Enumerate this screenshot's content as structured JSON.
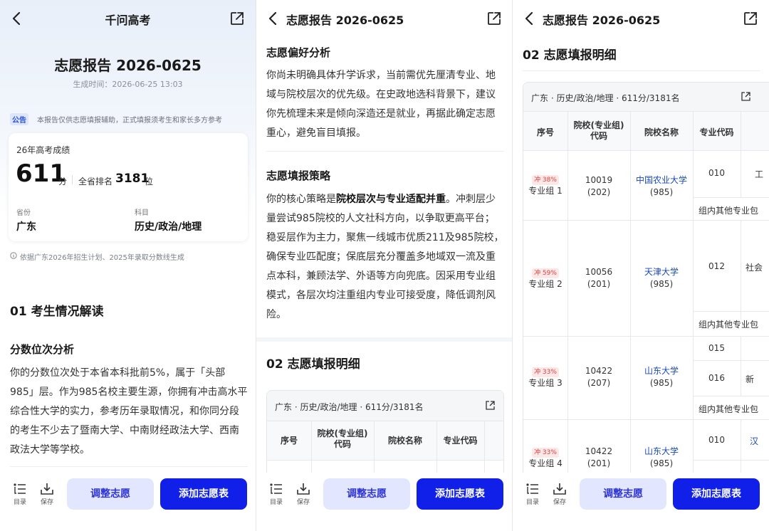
{
  "panel1": {
    "nav_title": "千问高考",
    "report_title": "志愿报告 2026-0625",
    "generated": "生成时间：2026-06-25 13:03",
    "notice_tag": "公告",
    "notice_text": "本报告仅供志愿填报辅助，正式填报须考生和家长多方参考",
    "score_card": {
      "label": "26年高考成绩",
      "score": "611",
      "score_unit": "分",
      "rank_prefix": "全省排名",
      "rank": "3181",
      "rank_unit": "位",
      "province_label": "省份",
      "province": "广东",
      "subject_label": "科目",
      "subjects": "历史/政治/地理"
    },
    "basis": "依据广东2026年招生计划、2025年录取分数线生成",
    "section1_title": "01  考生情况解读",
    "sub1_title": "分数位次分析",
    "sub1_text": "你的分数位次处于本省本科批前5%，属于「头部985」层。作为985名校主要生源，你拥有冲击高水平综合性大学的实力，参考历年录取情况，和你同分段的考生不少去了暨南大学、中南财经政法大学、西南政法大学等学校。"
  },
  "panel2": {
    "nav_title": "志愿报告 2026-0625",
    "pref_title": "志愿偏好分析",
    "pref_text": "你尚未明确具体升学诉求，当前需优先厘清专业、地域与院校层次的优先级。在史政地选科背景下，建议你先梳理未来是倾向深造还是就业，再据此确定志愿重心，避免盲目填报。",
    "strategy_title": "志愿填报策略",
    "strategy_lead": "你的核心策略是",
    "strategy_bold": "院校层次与专业适配并重",
    "strategy_rest": "。冲刺层少量尝试985院校的人文社科方向，以争取更高平台；稳妥层作为主力，聚焦一线城市优质211及985院校，确保专业匹配度；保底层充分覆盖多地域双一流及重点本科，兼顾法学、外语等方向兜底。因采用专业组模式，各层次均注重组内专业可接受度，降低调剂风险。",
    "section2_title": "02  志愿填报明细"
  },
  "panel3": {
    "nav_title": "志愿报告 2026-0625",
    "section2_title": "02  志愿填报明细"
  },
  "table": {
    "caption": "广东 · 历史/政治/地理 · 611分/3181名",
    "headers": [
      "序号",
      "院校(专业组)代码",
      "院校名称",
      "专业代码"
    ],
    "header_code_line1": "院校(专业组)",
    "header_code_line2": "代码",
    "other_majors": "组内其他专业包",
    "rows": [
      {
        "tag": "冲 38%",
        "group": "专业组 1",
        "code": "10019",
        "sub": "(202)",
        "school": "中国农业大学",
        "level": "(985)",
        "majors": [
          "010"
        ],
        "extra": [
          "工"
        ]
      },
      {
        "tag": "冲 59%",
        "group": "专业组 2",
        "code": "10056",
        "sub": "(201)",
        "school": "天津大学",
        "level": "(985)",
        "majors": [
          "012"
        ],
        "extra": [
          "社会"
        ]
      },
      {
        "tag": "冲 33%",
        "group": "专业组 3",
        "code": "10422",
        "sub": "(207)",
        "school": "山东大学",
        "level": "(985)",
        "majors": [
          "015",
          "016"
        ],
        "extra": [
          "",
          "新"
        ]
      },
      {
        "tag": "冲 33%",
        "group": "专业组 4",
        "code": "10422",
        "sub": "(201)",
        "school": "山东大学",
        "level": "(985)",
        "majors": [
          "010"
        ],
        "extra": [
          "汉"
        ]
      }
    ]
  },
  "bottom": {
    "toc_label": "目录",
    "save_label": "保存",
    "adjust_label": "调整志愿",
    "add_label": "添加志愿表"
  },
  "colors": {
    "accent": "#1020e8",
    "accent_light": "#e3e6ff",
    "tag_red": "#e03c3c",
    "school_link": "#1a49b5"
  }
}
